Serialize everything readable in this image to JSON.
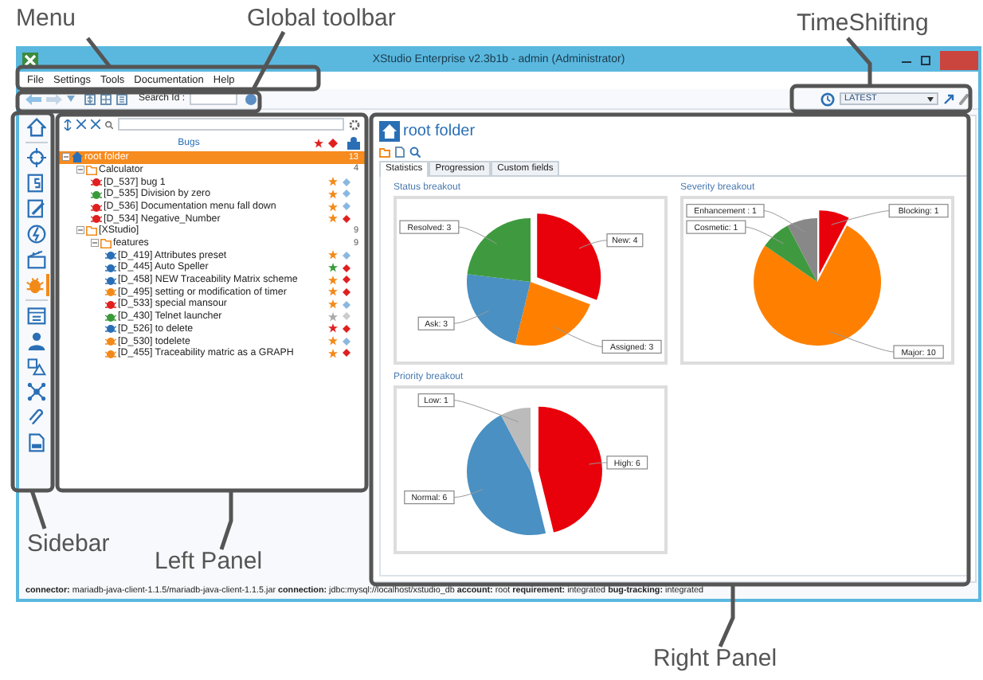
{
  "annotations": [
    {
      "label": "Menu"
    },
    {
      "label": "Global toolbar"
    },
    {
      "label": "TimeShifting"
    },
    {
      "label": "Sidebar"
    },
    {
      "label": "Left Panel"
    },
    {
      "label": "Right Panel"
    }
  ],
  "window": {
    "title": "XStudio Enterprise v2.3b1b - admin (Administrator)"
  },
  "menu": [
    "File",
    "Settings",
    "Tools",
    "Documentation",
    "Help"
  ],
  "toolbar": {
    "search_label": "Search Id :"
  },
  "timeshift": {
    "value": "LATEST"
  },
  "sidebar": {
    "items": [
      {
        "selected": false
      },
      {
        "selected": false
      },
      {
        "selected": false
      },
      {
        "selected": false
      },
      {
        "selected": false
      },
      {
        "selected": false
      },
      {
        "selected": true
      },
      {
        "selected": false
      },
      {
        "selected": false
      },
      {
        "selected": false
      },
      {
        "selected": false
      },
      {
        "selected": false
      },
      {
        "selected": false
      }
    ]
  },
  "left_panel": {
    "column_header": "Bugs",
    "tree": [
      {
        "kind": "root",
        "label": "root folder",
        "count": "13",
        "selected": true,
        "expanded": true,
        "children": [
          {
            "kind": "folder",
            "label": "Calculator",
            "count": "4",
            "selected": false,
            "expanded": true,
            "children": [
              {
                "kind": "bug",
                "label": "[D_537] bug 1",
                "color": "#e02020",
                "star": {
                  "color": "#f28a1a"
                },
                "flag": {
                  "color": "#8ab8e0"
                },
                "selected": false
              },
              {
                "kind": "bug",
                "label": "[D_535] Division by zero",
                "color": "#3a9a3a",
                "star": {
                  "color": "#f28a1a"
                },
                "flag": {
                  "color": "#8ab8e0"
                },
                "selected": false
              },
              {
                "kind": "bug",
                "label": "[D_536] Documentation menu fall down",
                "color": "#e02020",
                "star": {
                  "color": "#f28a1a"
                },
                "flag": {
                  "color": "#8ab8e0"
                },
                "selected": false
              },
              {
                "kind": "bug",
                "label": "[D_534] Negative_Number",
                "color": "#e02020",
                "star": {
                  "color": "#f28a1a"
                },
                "flag": {
                  "color": "#e02020"
                },
                "selected": false
              }
            ]
          },
          {
            "kind": "folder",
            "label": "[XStudio]",
            "count": "9",
            "selected": false,
            "expanded": true,
            "children": [
              {
                "kind": "folder",
                "label": "features",
                "count": "9",
                "selected": false,
                "expanded": true,
                "children": [
                  {
                    "kind": "bug",
                    "label": "[D_419] Attributes preset",
                    "color": "#2a6fb5",
                    "star": {
                      "color": "#f28a1a"
                    },
                    "flag": {
                      "color": "#8ab8e0"
                    },
                    "selected": false
                  },
                  {
                    "kind": "bug",
                    "label": "[D_445] Auto Speller",
                    "color": "#2a6fb5",
                    "star": {
                      "color": "#3a9a3a"
                    },
                    "flag": {
                      "color": "#e02020"
                    },
                    "selected": false
                  },
                  {
                    "kind": "bug",
                    "label": "[D_458] NEW Traceability Matrix scheme",
                    "color": "#2a6fb5",
                    "star": {
                      "color": "#f28a1a"
                    },
                    "flag": {
                      "color": "#e02020"
                    },
                    "selected": false
                  },
                  {
                    "kind": "bug",
                    "label": "[D_495] setting or modification of timer",
                    "color": "#f28a1a",
                    "star": {
                      "color": "#f28a1a"
                    },
                    "flag": {
                      "color": "#e02020"
                    },
                    "selected": false
                  },
                  {
                    "kind": "bug",
                    "label": "[D_533] special mansour",
                    "color": "#e02020",
                    "star": {
                      "color": "#f28a1a"
                    },
                    "flag": {
                      "color": "#8ab8e0"
                    },
                    "selected": false
                  },
                  {
                    "kind": "bug",
                    "label": "[D_430] Telnet launcher",
                    "color": "#3a9a3a",
                    "star": {
                      "color": "#aaaaaa"
                    },
                    "flag": {
                      "color": "#cccccc"
                    },
                    "selected": false
                  },
                  {
                    "kind": "bug",
                    "label": "[D_526] to delete",
                    "color": "#2a6fb5",
                    "star": {
                      "color": "#e02020"
                    },
                    "flag": {
                      "color": "#e02020"
                    },
                    "selected": false
                  },
                  {
                    "kind": "bug",
                    "label": "[D_530] todelete",
                    "color": "#f28a1a",
                    "star": {
                      "color": "#f28a1a"
                    },
                    "flag": {
                      "color": "#8ab8e0"
                    },
                    "selected": false
                  },
                  {
                    "kind": "bug",
                    "label": "[D_455] Traceability matric as a GRAPH",
                    "color": "#f28a1a",
                    "star": {
                      "color": "#f28a1a"
                    },
                    "flag": {
                      "color": "#e02020"
                    },
                    "selected": false
                  }
                ]
              }
            ]
          }
        ]
      }
    ]
  },
  "right_panel": {
    "title": "root folder",
    "tabs": [
      {
        "label": "Statistics",
        "selected": true
      },
      {
        "label": "Progression",
        "selected": false
      },
      {
        "label": "Custom fields",
        "selected": false
      }
    ],
    "charts": [
      {
        "title": "Status breakout",
        "chart_data": {
          "type": "pie",
          "categories": [
            "New: 4",
            "Assigned: 3",
            "Ask: 3",
            "Resolved: 3"
          ],
          "values": [
            4,
            3,
            3,
            3
          ],
          "colors": [
            "#e8000b",
            "#ff8000",
            "#4a90c2",
            "#3f9a3f"
          ]
        }
      },
      {
        "title": "Severity breakout",
        "chart_data": {
          "type": "pie",
          "categories": [
            "Blocking: 1",
            "Major: 10",
            "Cosmetic: 1",
            "Enhancement : 1"
          ],
          "values": [
            1,
            10,
            1,
            1
          ],
          "colors": [
            "#e8000b",
            "#ff8000",
            "#3f9a3f",
            "#888888"
          ]
        }
      },
      {
        "title": "Priority breakout",
        "chart_data": {
          "type": "pie",
          "categories": [
            "High: 6",
            "Normal: 6",
            "Low: 1"
          ],
          "values": [
            6,
            6,
            1
          ],
          "colors": [
            "#e8000b",
            "#4a90c2",
            "#bbbbbb"
          ]
        }
      }
    ]
  },
  "status_bar": "**connector:** mariadb-java-client-1.1.5/mariadb-java-client-1.1.5.jar **connection:** jdbc:mysql://localhost/xstudio_db **account:** root **requirement:** integrated **bug-tracking:** integrated"
}
